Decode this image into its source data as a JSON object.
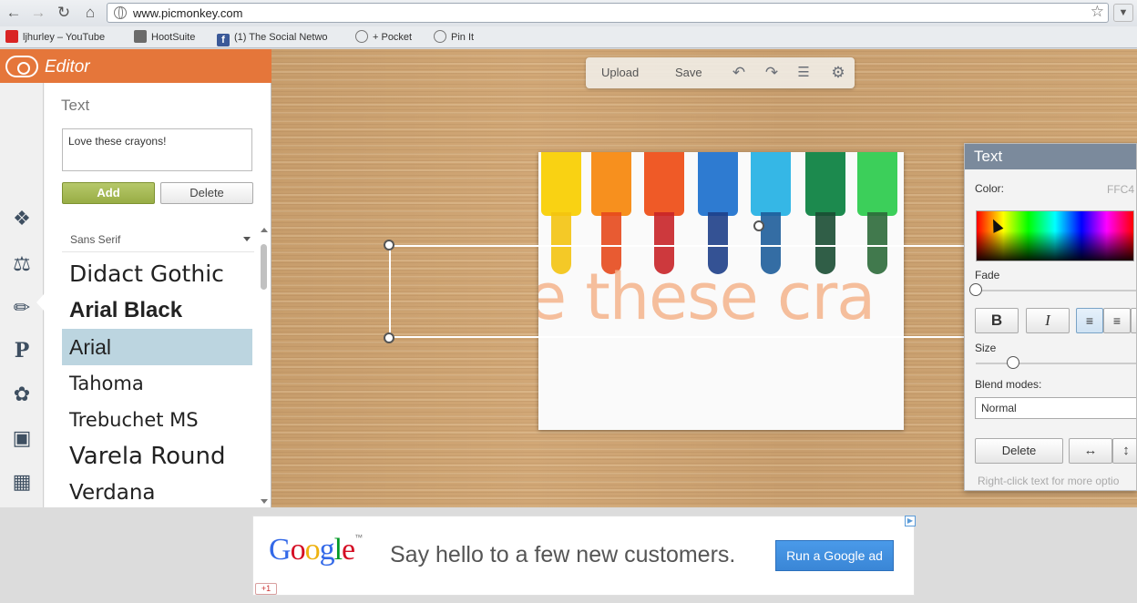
{
  "browser": {
    "url": "www.picmonkey.com",
    "nav": {
      "back_icon": "back-arrow-icon",
      "forward_icon": "forward-arrow-icon",
      "reload_icon": "reload-icon",
      "home_icon": "home-icon"
    },
    "bookmarks": [
      {
        "label": "ljhurley – YouTube",
        "icon": "youtube-icon"
      },
      {
        "label": "HootSuite",
        "icon": "hootsuite-icon"
      },
      {
        "label": "(1) The Social Netwo",
        "icon": "facebook-icon"
      },
      {
        "label": "+ Pocket",
        "icon": "globe-icon"
      },
      {
        "label": "Pin It",
        "icon": "globe-icon"
      }
    ]
  },
  "editor": {
    "title": "Editor",
    "rail_icons": [
      "basic-edits-icon",
      "effects-icon",
      "touch-up-icon",
      "text-icon",
      "overlays-icon",
      "frames-icon",
      "textures-icon"
    ],
    "text_panel": {
      "title": "Text",
      "input_value": "Love these crayons!",
      "add_label": "Add",
      "delete_label": "Delete",
      "font_filter": "Sans Serif",
      "fonts": [
        {
          "name": "Didact Gothic",
          "selected": false
        },
        {
          "name": "Arial Black",
          "selected": false
        },
        {
          "name": "Arial",
          "selected": true
        },
        {
          "name": "Tahoma",
          "selected": false
        },
        {
          "name": "Trebuchet MS",
          "selected": false
        },
        {
          "name": "Varela Round",
          "selected": false
        },
        {
          "name": "Verdana",
          "selected": false
        }
      ]
    }
  },
  "toolbar": {
    "upload_label": "Upload",
    "save_label": "Save",
    "icons": [
      "undo-icon",
      "redo-icon",
      "layers-icon",
      "settings-gear-icon"
    ]
  },
  "canvas": {
    "overlay_text": "e these cra",
    "marker_colors": [
      "#f9d213",
      "#f7901e",
      "#ef5a27",
      "#2e7bd1",
      "#35b7e6",
      "#1c8a4e",
      "#3ccf5a"
    ]
  },
  "text_props": {
    "title": "Text",
    "color_label": "Color:",
    "color_hex": "FFC4",
    "fade_label": "Fade",
    "fade_value": 0.0,
    "bold_label": "B",
    "italic_label": "I",
    "size_label": "Size",
    "size_value": 0.23,
    "blend_label": "Blend modes:",
    "blend_value": "Normal",
    "delete_label": "Delete",
    "hint": "Right-click text for more optio"
  },
  "ad": {
    "logo": "Google",
    "tm": "™",
    "text": "Say hello to a few new customers.",
    "button_label": "Run a Google ad",
    "plus_label": "+1"
  }
}
